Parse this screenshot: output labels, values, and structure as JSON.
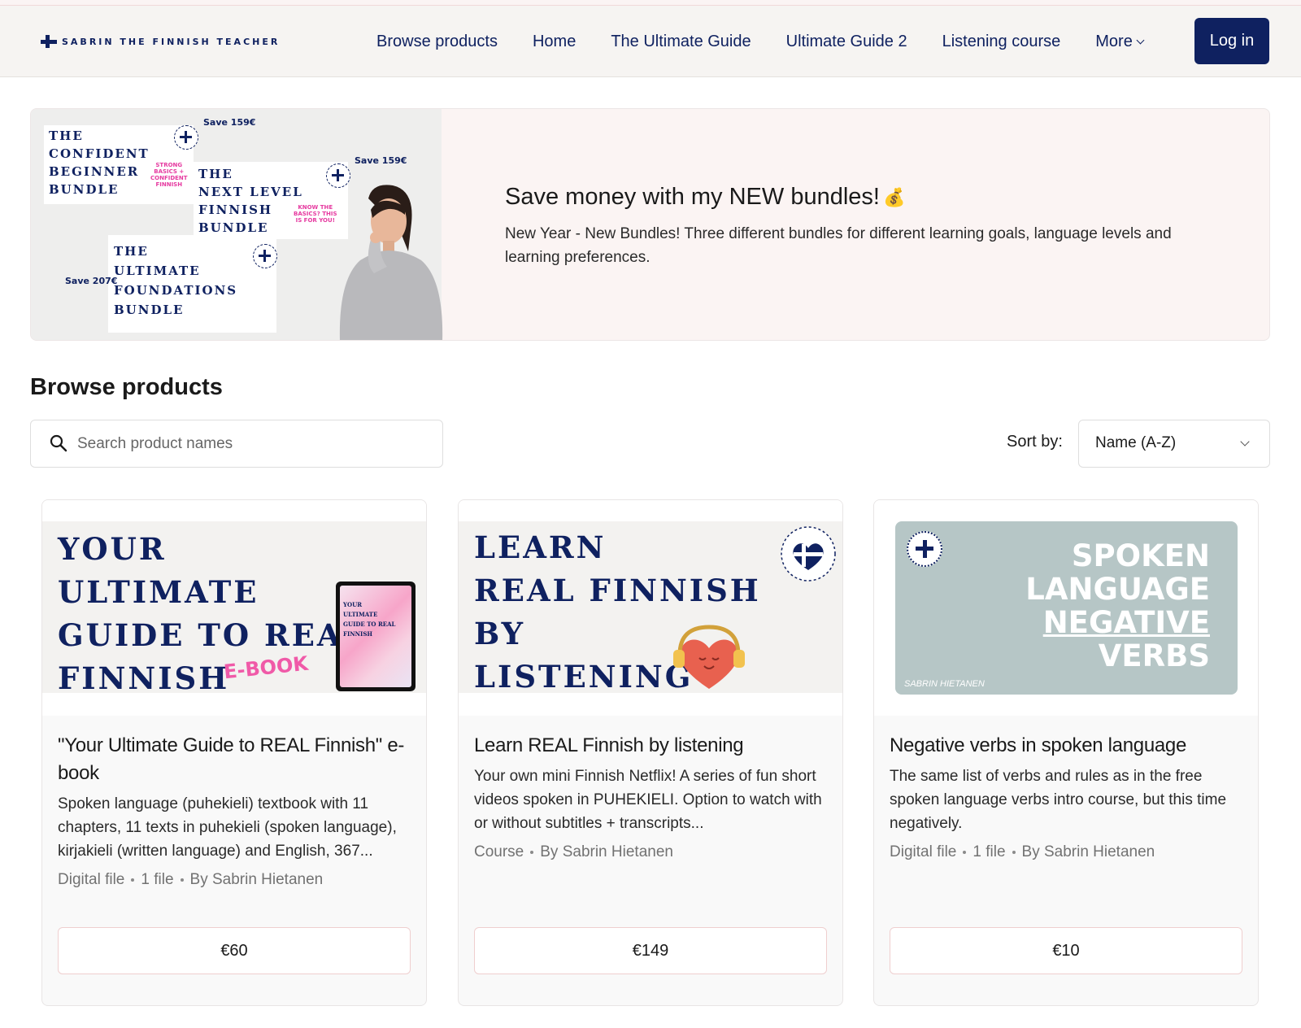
{
  "header": {
    "logo_text": "SABRIN THE FINNISH TEACHER",
    "nav": [
      "Browse products",
      "Home",
      "The Ultimate Guide",
      "Ultimate Guide 2",
      "Listening course"
    ],
    "more_label": "More",
    "login_label": "Log in"
  },
  "banner": {
    "heading": "Save money with my NEW bundles!",
    "heading_emoji": "💰",
    "description": "New Year - New Bundles! Three different bundles for different learning goals, language levels and learning preferences.",
    "image": {
      "bundles": [
        {
          "title": "THE\nCONFIDENT\nBEGINNER\nBUNDLE",
          "save": "Save 159€",
          "tag": "STRONG\nBASICS +\nCONFIDENT\nFINNISH"
        },
        {
          "title": "THE\nNEXT LEVEL\nFINNISH\nBUNDLE",
          "save": "Save 159€",
          "tag": "KNOW THE\nBASICS? THIS\nIS FOR YOU!"
        },
        {
          "title": "THE\nULTIMATE\nFOUNDATIONS\nBUNDLE",
          "save": "Save 207€",
          "tag": ""
        }
      ]
    }
  },
  "browse": {
    "title": "Browse products",
    "search_placeholder": "Search product names",
    "sort_label": "Sort by:",
    "sort_value": "Name (A-Z)"
  },
  "products": [
    {
      "thumb_text": "YOUR\nULTIMATE\nGUIDE TO REAL\nFINNISH",
      "thumb_badge": "E-BOOK",
      "thumb_tablet": "YOUR\nULTIMATE\nGUIDE TO REAL\nFINNISH",
      "title": "\"Your Ultimate Guide to REAL Finnish\" e-book",
      "description": "Spoken language (puhekieli) textbook with 11 chapters, 11 texts in puhekieli (spoken language), kirjakieli (written language) and English, 367...",
      "meta": [
        "Digital file",
        "1 file",
        "By Sabrin Hietanen"
      ],
      "price": "€60"
    },
    {
      "thumb_text": "LEARN\nREAL FINNISH\nBY\nLISTENING",
      "title": "Learn REAL Finnish by listening",
      "description": "Your own mini Finnish Netflix! A series of fun short videos spoken in PUHEKIELI. Option to watch with or without subtitles + transcripts...",
      "meta": [
        "Course",
        "By Sabrin Hietanen"
      ],
      "price": "€149"
    },
    {
      "thumb_lines": [
        "SPOKEN",
        "LANGUAGE",
        "NEGATIVE",
        "VERBS"
      ],
      "thumb_author": "SABRIN HIETANEN",
      "title": "Negative verbs in spoken language",
      "description": "The same list of verbs and rules as in the free spoken language verbs intro course, but this time negatively.",
      "meta": [
        "Digital file",
        "1 file",
        "By Sabrin Hietanen"
      ],
      "price": "€10"
    }
  ]
}
